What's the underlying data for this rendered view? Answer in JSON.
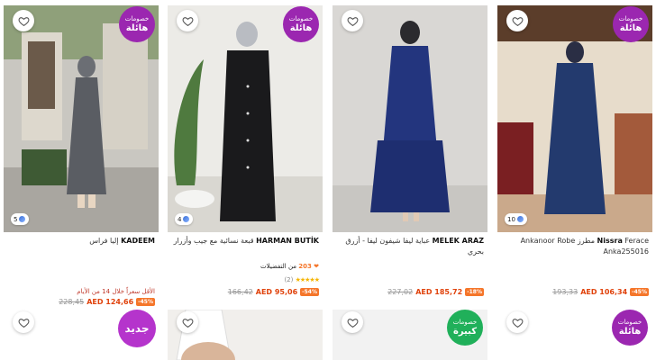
{
  "promo": {
    "line1": "خصومات",
    "line2": "هائلة"
  },
  "promo_big": {
    "line1": "خصومات",
    "line2": "كبيرة"
  },
  "new_badge": "جديد",
  "products": [
    {
      "brand": "KADEEM",
      "name": "إليا فراس",
      "colors": "5",
      "lowest_note": "الأقل سعراً خلال 14 من الأيام",
      "old_price": "228,45",
      "price": "AED 124,66",
      "discount": "-45%"
    },
    {
      "brand": "HARMAN BUTİK",
      "name": "قبعة نسائية مع جيب وأزرار",
      "colors": "4",
      "favorites_count": "203",
      "favorites_label": "من التفضيلات",
      "rating_count": "(2)",
      "old_price": "166,42",
      "price": "AED 95,06",
      "discount": "-54%"
    },
    {
      "brand": "MELEK ARAZ",
      "name": "عباية ليفا شيفون ليفا - أزرق بحري",
      "old_price": "227,02",
      "price": "AED 185,72",
      "discount": "-18%"
    },
    {
      "brand": "Nissra",
      "name": "Ferace مطرز Ankanoor Robe Anka255016",
      "colors": "10",
      "old_price": "193,33",
      "price": "AED 106,34",
      "discount": "-45%"
    }
  ],
  "colors": {
    "accent_orange": "#e0420b",
    "promo_purple": "#9b27b0",
    "promo_green": "#20b05a",
    "discount_bg": "#f5762a"
  }
}
